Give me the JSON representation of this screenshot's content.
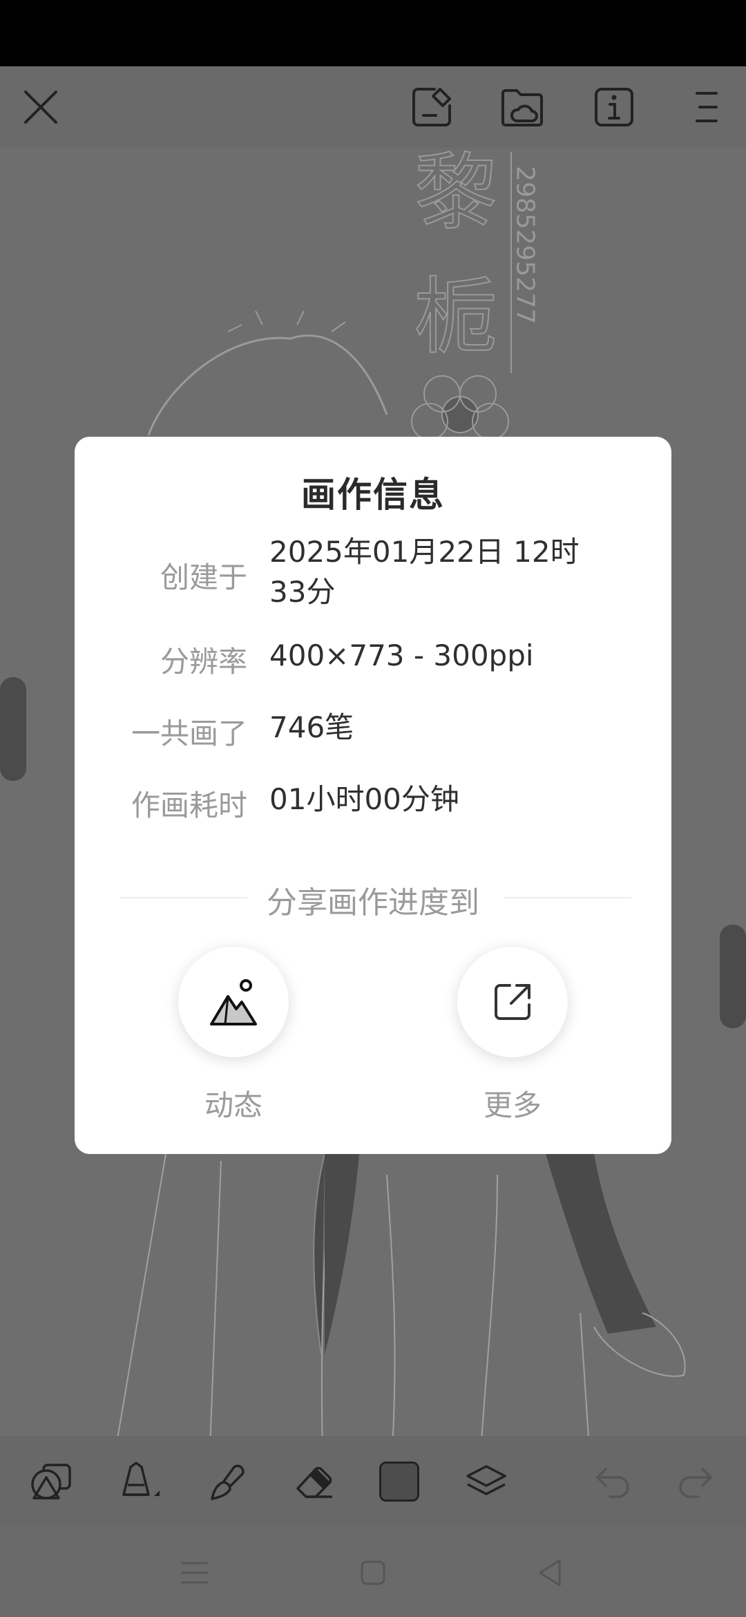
{
  "dialog": {
    "title": "画作信息",
    "rows": [
      {
        "label": "创建于",
        "value": "2025年01月22日 12时33分"
      },
      {
        "label": "分辨率",
        "value": "400×773 - 300ppi"
      },
      {
        "label": "一共画了",
        "value": "746笔"
      },
      {
        "label": "作画耗时",
        "value": "01小时00分钟"
      }
    ],
    "share_title": "分享画作进度到",
    "share_targets": [
      {
        "label": "动态",
        "icon": "mountain-photo-icon"
      },
      {
        "label": "更多",
        "icon": "external-share-icon"
      }
    ]
  },
  "canvas": {
    "handwriting_glyphs": [
      "黎",
      "栀"
    ],
    "handwriting_digits": "2985295277"
  },
  "colors": {
    "overlay": "#6c6c6c",
    "dialog_bg": "#ffffff",
    "label_gray": "#9a9a9a",
    "value_dark": "#2f2f2f",
    "status_bar": "#000000"
  }
}
